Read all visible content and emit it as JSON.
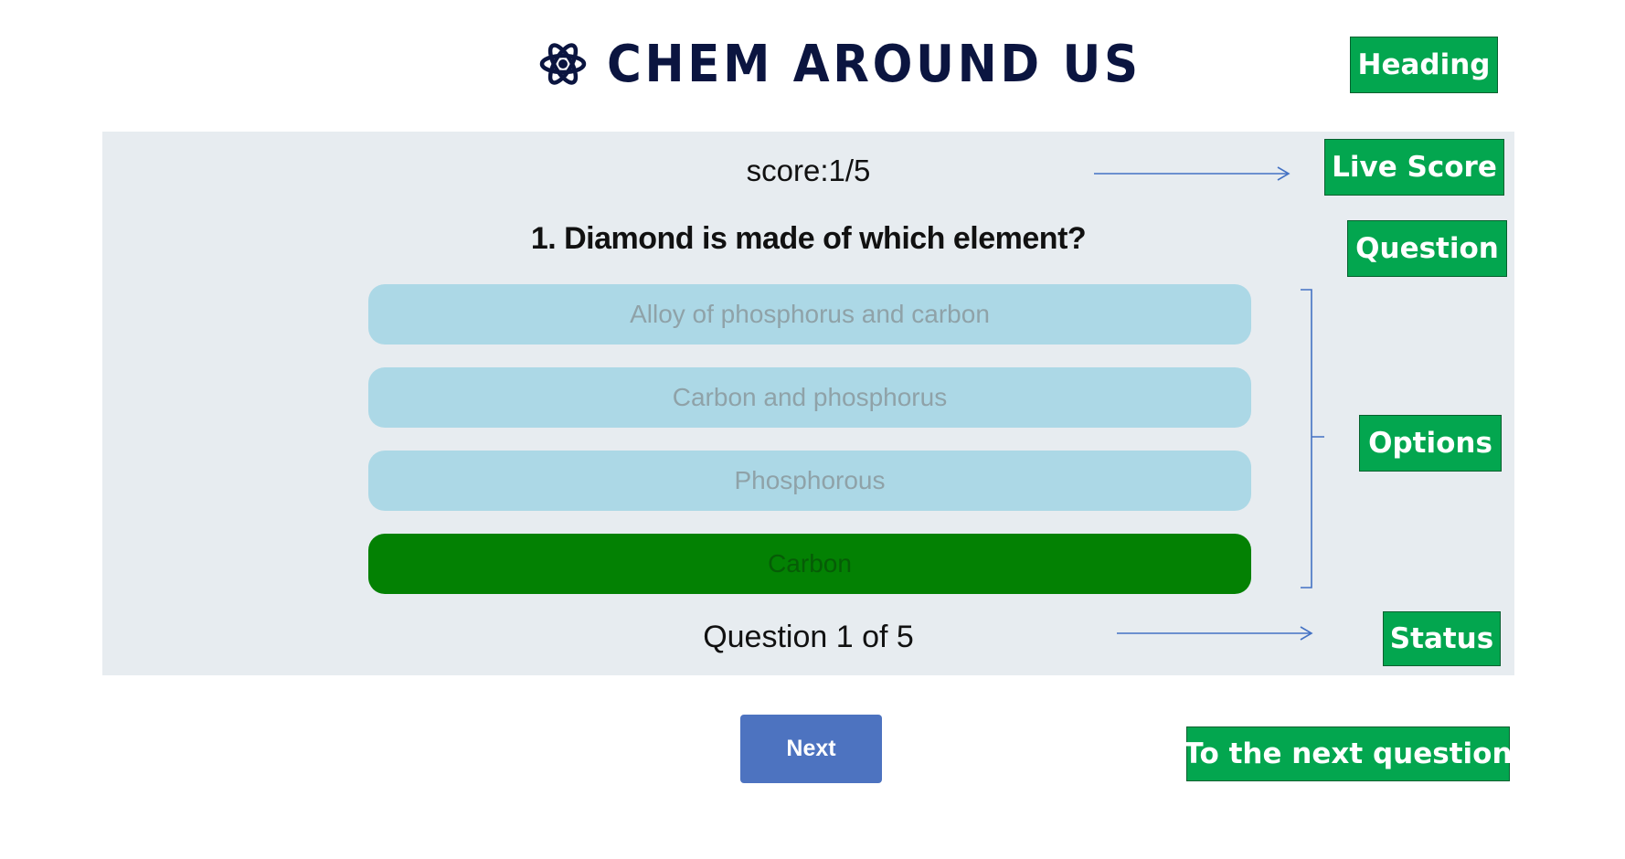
{
  "header": {
    "title": "CHEM AROUND US",
    "logo_icon": "atom-icon"
  },
  "quiz": {
    "score": "score:1/5",
    "question": "1. Diamond is made of which element?",
    "options": [
      {
        "label": "Alloy of phosphorus and carbon",
        "state": "default"
      },
      {
        "label": "Carbon and phosphorus",
        "state": "default"
      },
      {
        "label": "Phosphorous",
        "state": "default"
      },
      {
        "label": "Carbon",
        "state": "correct"
      }
    ],
    "status": "Question 1 of 5",
    "next_label": "Next"
  },
  "annotations": {
    "heading": "Heading",
    "live_score": "Live Score",
    "question": "Question",
    "options": "Options",
    "status": "Status",
    "next_question": "To the next question"
  },
  "colors": {
    "title": "#0b1540",
    "panel": "#e7ecf0",
    "option": "#acd8e6",
    "option_correct": "#038103",
    "next_button": "#4d73c0",
    "annotation": "#03a64f",
    "arrow": "#4472c4"
  }
}
